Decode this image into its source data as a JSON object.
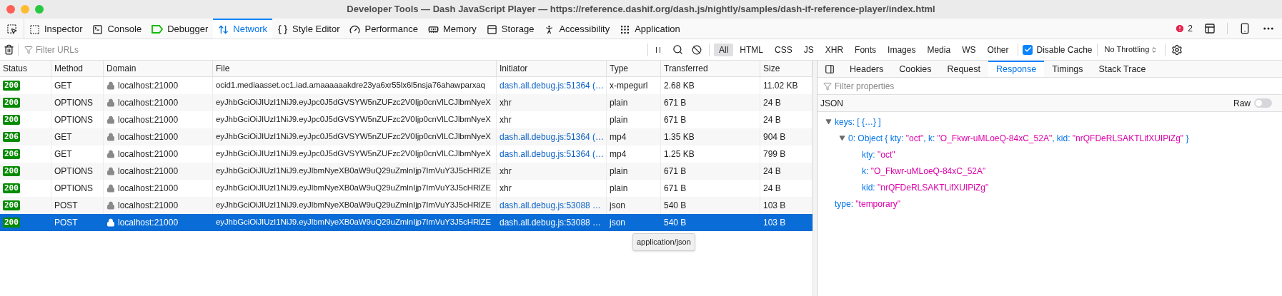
{
  "window": {
    "title": "Developer Tools — Dash JavaScript Player — https://reference.dashif.org/dash.js/nightly/samples/dash-if-reference-player/index.html"
  },
  "toolbar": {
    "tabs": [
      {
        "label": "Inspector",
        "selected": false
      },
      {
        "label": "Console",
        "selected": false
      },
      {
        "label": "Debugger",
        "selected": false
      },
      {
        "label": "Network",
        "selected": true
      },
      {
        "label": "Style Editor",
        "selected": false
      },
      {
        "label": "Performance",
        "selected": false
      },
      {
        "label": "Memory",
        "selected": false
      },
      {
        "label": "Storage",
        "selected": false
      },
      {
        "label": "Accessibility",
        "selected": false
      },
      {
        "label": "Application",
        "selected": false
      }
    ],
    "error_count": "2"
  },
  "filter_bar": {
    "placeholder": "Filter URLs",
    "type_filters": [
      {
        "label": "All",
        "selected": true
      },
      {
        "label": "HTML",
        "selected": false
      },
      {
        "label": "CSS",
        "selected": false
      },
      {
        "label": "JS",
        "selected": false
      },
      {
        "label": "XHR",
        "selected": false
      },
      {
        "label": "Fonts",
        "selected": false
      },
      {
        "label": "Images",
        "selected": false
      },
      {
        "label": "Media",
        "selected": false
      },
      {
        "label": "WS",
        "selected": false
      },
      {
        "label": "Other",
        "selected": false
      }
    ],
    "disable_cache": {
      "label": "Disable Cache",
      "checked": true
    },
    "throttling": "No Throttling"
  },
  "table": {
    "columns": [
      "Status",
      "Method",
      "Domain",
      "File",
      "Initiator",
      "Type",
      "Transferred",
      "Size"
    ],
    "rows": [
      {
        "status": "200",
        "method": "GET",
        "domain": "localhost:21000",
        "file": "ocid1.mediaasset.oc1.iad.amaaaaaakdre23ya6xr55lx6l5nsja76ahawparxaq",
        "initiator": "dash.all.debug.js:51364 (…",
        "initiator_is_link": true,
        "type": "x-mpegurl",
        "transferred": "2.68 KB",
        "size": "11.02 KB",
        "selected": false
      },
      {
        "status": "200",
        "method": "OPTIONS",
        "domain": "localhost:21000",
        "file": "eyJhbGciOiJIUzI1NiJ9.eyJpc0J5dGVSYW5nZUFzc2V0Ijp0cnVlLCJlbmNyeX",
        "initiator": "xhr",
        "initiator_is_link": false,
        "type": "plain",
        "transferred": "671 B",
        "size": "24 B",
        "selected": false
      },
      {
        "status": "200",
        "method": "OPTIONS",
        "domain": "localhost:21000",
        "file": "eyJhbGciOiJIUzI1NiJ9.eyJpc0J5dGVSYW5nZUFzc2V0Ijp0cnVlLCJlbmNyeX",
        "initiator": "xhr",
        "initiator_is_link": false,
        "type": "plain",
        "transferred": "671 B",
        "size": "24 B",
        "selected": false
      },
      {
        "status": "206",
        "method": "GET",
        "domain": "localhost:21000",
        "file": "eyJhbGciOiJIUzI1NiJ9.eyJpc0J5dGVSYW5nZUFzc2V0Ijp0cnVlLCJlbmNyeX",
        "initiator": "dash.all.debug.js:51364 (…",
        "initiator_is_link": true,
        "type": "mp4",
        "transferred": "1.35 KB",
        "size": "904 B",
        "selected": false
      },
      {
        "status": "206",
        "method": "GET",
        "domain": "localhost:21000",
        "file": "eyJhbGciOiJIUzI1NiJ9.eyJpc0J5dGVSYW5nZUFzc2V0Ijp0cnVlLCJlbmNyeX",
        "initiator": "dash.all.debug.js:51364 (…",
        "initiator_is_link": true,
        "type": "mp4",
        "transferred": "1.25 KB",
        "size": "799 B",
        "selected": false
      },
      {
        "status": "200",
        "method": "OPTIONS",
        "domain": "localhost:21000",
        "file": "eyJhbGciOiJIUzI1NiJ9.eyJlbmNyeXB0aW9uQ29uZmlnIjp7ImVuY3J5cHRlZE",
        "initiator": "xhr",
        "initiator_is_link": false,
        "type": "plain",
        "transferred": "671 B",
        "size": "24 B",
        "selected": false
      },
      {
        "status": "200",
        "method": "OPTIONS",
        "domain": "localhost:21000",
        "file": "eyJhbGciOiJIUzI1NiJ9.eyJlbmNyeXB0aW9uQ29uZmlnIjp7ImVuY3J5cHRlZE",
        "initiator": "xhr",
        "initiator_is_link": false,
        "type": "plain",
        "transferred": "671 B",
        "size": "24 B",
        "selected": false
      },
      {
        "status": "200",
        "method": "POST",
        "domain": "localhost:21000",
        "file": "eyJhbGciOiJIUzI1NiJ9.eyJlbmNyeXB0aW9uQ29uZmlnIjp7ImVuY3J5cHRlZE",
        "initiator": "dash.all.debug.js:53088 …",
        "initiator_is_link": true,
        "type": "json",
        "transferred": "540 B",
        "size": "103 B",
        "selected": false
      },
      {
        "status": "200",
        "method": "POST",
        "domain": "localhost:21000",
        "file": "eyJhbGciOiJIUzI1NiJ9.eyJlbmNyeXB0aW9uQ29uZmlnIjp7ImVuY3J5cHRlZE",
        "initiator": "dash.all.debug.js:53088 …",
        "initiator_is_link": true,
        "type": "json",
        "transferred": "540 B",
        "size": "103 B",
        "selected": true
      }
    ],
    "tooltip": "application/json"
  },
  "details": {
    "tabs": [
      {
        "label": "Headers",
        "selected": false
      },
      {
        "label": "Cookies",
        "selected": false
      },
      {
        "label": "Request",
        "selected": false
      },
      {
        "label": "Response",
        "selected": true
      },
      {
        "label": "Timings",
        "selected": false
      },
      {
        "label": "Stack Trace",
        "selected": false
      }
    ],
    "filter_placeholder": "Filter properties",
    "section": "JSON",
    "raw": {
      "label": "Raw",
      "on": false
    },
    "tree": [
      {
        "segments": [
          {
            "kind": "key",
            "text": "keys: [ {…} ]"
          }
        ],
        "expanded": true,
        "children": [
          {
            "segments": [
              {
                "kind": "key",
                "text": "0: Object { kty: "
              },
              {
                "kind": "string",
                "text": "\"oct\""
              },
              {
                "kind": "key",
                "text": ", k: "
              },
              {
                "kind": "string",
                "text": "\"O_Fkwr-uMLoeQ-84xC_52A\""
              },
              {
                "kind": "key",
                "text": ", kid: "
              },
              {
                "kind": "string",
                "text": "\"nrQFDeRLSAKTLifXUIPiZg\""
              },
              {
                "kind": "key",
                "text": " }"
              }
            ],
            "expanded": true,
            "children": [
              {
                "segments": [
                  {
                    "kind": "key",
                    "text": "kty: "
                  },
                  {
                    "kind": "string",
                    "text": "\"oct\""
                  }
                ]
              },
              {
                "segments": [
                  {
                    "kind": "key",
                    "text": "k: "
                  },
                  {
                    "kind": "string",
                    "text": "\"O_Fkwr-uMLoeQ-84xC_52A\""
                  }
                ]
              },
              {
                "segments": [
                  {
                    "kind": "key",
                    "text": "kid: "
                  },
                  {
                    "kind": "string",
                    "text": "\"nrQFDeRLSAKTLifXUIPiZg\""
                  }
                ]
              }
            ]
          }
        ]
      },
      {
        "segments": [
          {
            "kind": "key",
            "text": "type: "
          },
          {
            "kind": "string",
            "text": "\"temporary\""
          }
        ]
      }
    ]
  }
}
